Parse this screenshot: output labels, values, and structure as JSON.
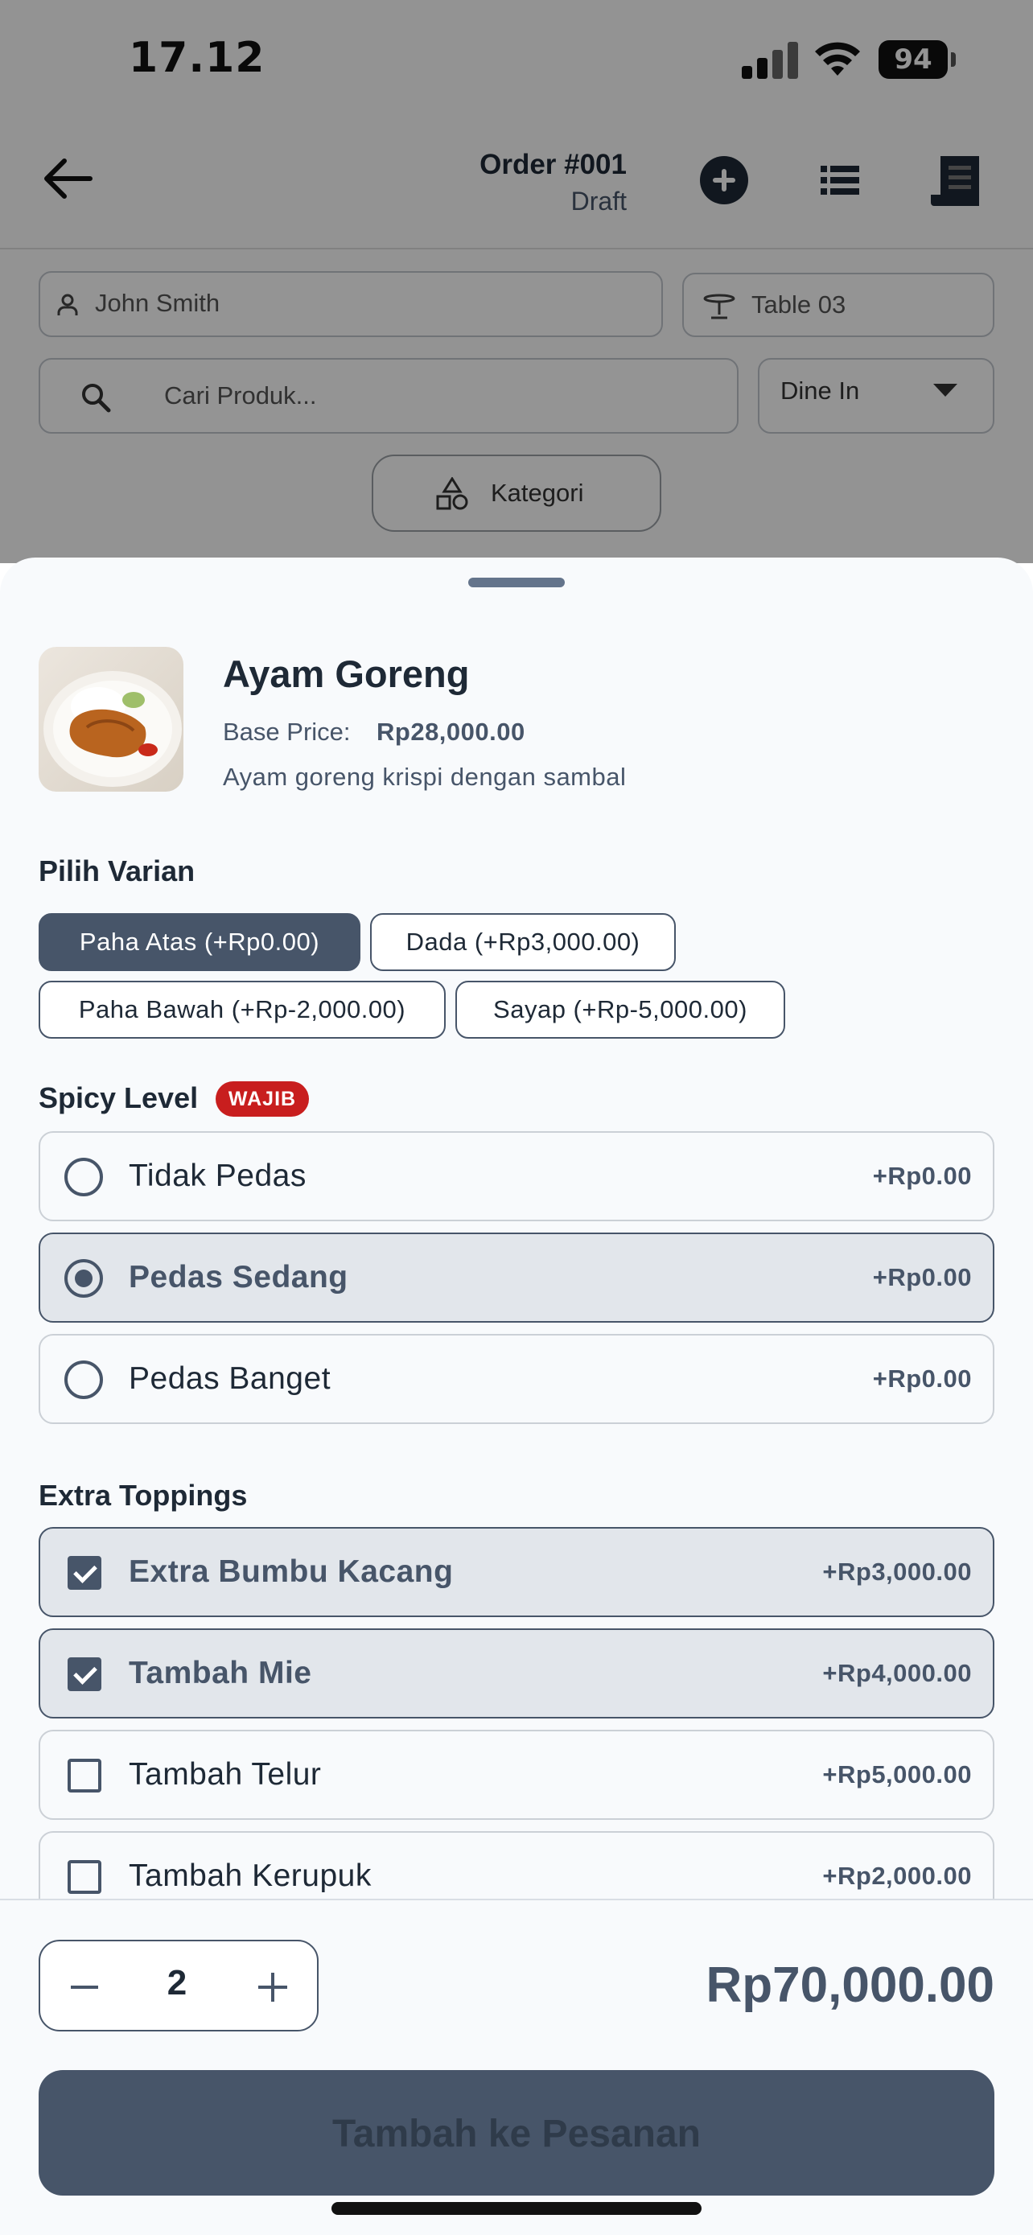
{
  "status_bar": {
    "time": "17.12",
    "battery": "94"
  },
  "header": {
    "order_title": "Order #001",
    "order_status": "Draft",
    "back_icon": "arrow-left-icon",
    "add_icon": "plus-circle-icon",
    "list_icon": "list-icon",
    "receipt_icon": "receipt-icon"
  },
  "form": {
    "customer": "John Smith",
    "table": "Table 03",
    "search_placeholder": "Cari Produk...",
    "order_type": "Dine In",
    "category_button": "Kategori"
  },
  "product": {
    "name": "Ayam Goreng",
    "base_price_label": "Base Price:",
    "base_price": "Rp28,000.00",
    "description": "Ayam goreng krispi dengan sambal"
  },
  "variants": {
    "title": "Pilih Varian",
    "items": [
      {
        "label": "Paha Atas (+Rp0.00)",
        "selected": true
      },
      {
        "label": "Dada (+Rp3,000.00)",
        "selected": false
      },
      {
        "label": "Paha Bawah (+Rp-2,000.00)",
        "selected": false
      },
      {
        "label": "Sayap (+Rp-5,000.00)",
        "selected": false
      }
    ]
  },
  "spicy": {
    "title": "Spicy Level",
    "badge": "WAJIB",
    "options": [
      {
        "label": "Tidak Pedas",
        "price": "+Rp0.00",
        "selected": false
      },
      {
        "label": "Pedas Sedang",
        "price": "+Rp0.00",
        "selected": true
      },
      {
        "label": "Pedas Banget",
        "price": "+Rp0.00",
        "selected": false
      }
    ]
  },
  "toppings": {
    "title": "Extra Toppings",
    "options": [
      {
        "label": "Extra Bumbu Kacang",
        "price": "+Rp3,000.00",
        "checked": true
      },
      {
        "label": "Tambah Mie",
        "price": "+Rp4,000.00",
        "checked": true
      },
      {
        "label": "Tambah Telur",
        "price": "+Rp5,000.00",
        "checked": false
      },
      {
        "label": "Tambah Kerupuk",
        "price": "+Rp2,000.00",
        "checked": false
      }
    ]
  },
  "footer": {
    "quantity": "2",
    "total": "Rp70,000.00",
    "submit_label": "Tambah ke Pesanan"
  },
  "colors": {
    "primary": "#475569",
    "text": "#1e2936",
    "badge": "#c81e1e"
  }
}
